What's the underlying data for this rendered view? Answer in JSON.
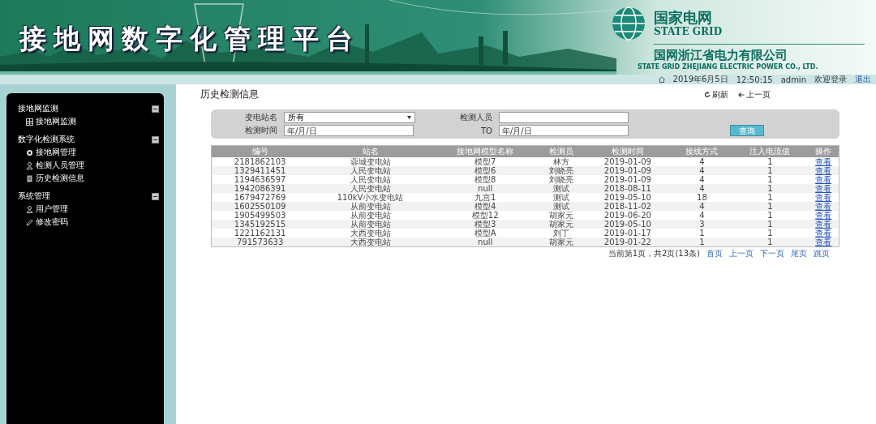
{
  "header": {
    "title": "接地网数字化管理平台",
    "logo": {
      "name": "国家电网",
      "name_en": "STATE GRID",
      "company": "国网浙江省电力有限公司",
      "company_en": "STATE GRID ZHEJIANG ELECTRIC POWER CO., LTD."
    }
  },
  "user_bar": {
    "date": "2019年6月5日",
    "time": "12:50:15",
    "user": "admin",
    "welcome": "欢迎登录",
    "logout": "退出"
  },
  "sidebar": {
    "sections": [
      {
        "label": "接地网监测",
        "expanded": true,
        "items": [
          {
            "label": "接地网监测"
          }
        ]
      },
      {
        "label": "数字化检测系统",
        "expanded": true,
        "items": [
          {
            "label": "接地网管理"
          },
          {
            "label": "检测人员管理"
          },
          {
            "label": "历史检测信息"
          }
        ]
      },
      {
        "label": "系统管理",
        "expanded": true,
        "items": [
          {
            "label": "用户管理"
          },
          {
            "label": "修改密码"
          }
        ]
      }
    ]
  },
  "page": {
    "title": "历史检测信息",
    "actions": [
      {
        "label": "刷新",
        "kind": "refresh"
      },
      {
        "label": "上一页",
        "kind": "back"
      }
    ]
  },
  "filter": {
    "station_label": "变电站名",
    "station_value": "所有",
    "inspector_label": "检测人员",
    "time_label": "检测时间",
    "from_placeholder": "年/月/日",
    "to_label": "TO",
    "to_placeholder": "年/月/日",
    "search_button": "查询"
  },
  "table": {
    "columns": [
      "编号",
      "站名",
      "接地网模型名称",
      "检测员",
      "检测时间",
      "接线方式",
      "注入电流值",
      "操作"
    ],
    "rows": [
      [
        "2181862103",
        "蓉城变电站",
        "模型7",
        "林方",
        "2019-01-09",
        "4",
        "1",
        "查看"
      ],
      [
        "1329411451",
        "人民变电站",
        "模型6",
        "刘晓亮",
        "2019-01-09",
        "4",
        "1",
        "查看"
      ],
      [
        "1194636597",
        "人民变电站",
        "模型8",
        "刘晓亮",
        "2019-01-09",
        "4",
        "1",
        "查看"
      ],
      [
        "1942086391",
        "人民变电站",
        "null",
        "测试",
        "2018-08-11",
        "4",
        "1",
        "查看"
      ],
      [
        "1679472769",
        "110kV小水变电站",
        "九宫1",
        "测试",
        "2019-05-10",
        "18",
        "1",
        "查看"
      ],
      [
        "1602550109",
        "从前变电站",
        "模型4",
        "测试",
        "2018-11-02",
        "4",
        "1",
        "查看"
      ],
      [
        "1905499503",
        "从前变电站",
        "模型12",
        "胡家元",
        "2019-06-20",
        "4",
        "1",
        "查看"
      ],
      [
        "1345192515",
        "从前变电站",
        "模型3",
        "胡家元",
        "2019-05-10",
        "3",
        "1",
        "查看"
      ],
      [
        "1221162131",
        "大西变电站",
        "模型A",
        "刘丁",
        "2019-01-17",
        "1",
        "1",
        "查看"
      ],
      [
        "791573633",
        "大西变电站",
        "null",
        "胡家元",
        "2019-01-22",
        "1",
        "1",
        "查看"
      ]
    ]
  },
  "pagination": {
    "info": "当前第1页，共2页(13条)",
    "links": [
      "首页",
      "上一页",
      "下一页",
      "尾页"
    ],
    "jump": "跳页"
  }
}
